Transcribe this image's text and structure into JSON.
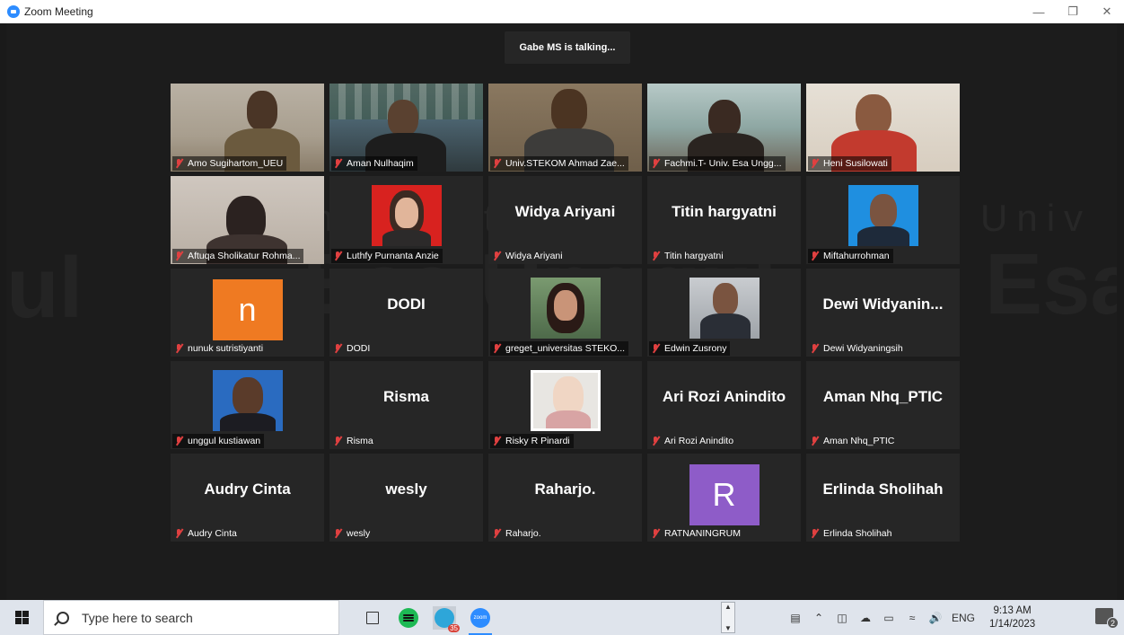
{
  "window": {
    "title": "Zoom Meeting"
  },
  "meeting": {
    "speaker_banner": "Gabe MS is talking...",
    "watermark_line1": "Univ",
    "watermark_line1b": "ersitas",
    "watermark_line2": "Esa Unggul",
    "watermark_line2b": "Esa",
    "watermark_line2c": "ul"
  },
  "participants": [
    {
      "label": "Amo Sugihartom_UEU",
      "kind": "video"
    },
    {
      "label": "Aman Nulhaqim",
      "kind": "video"
    },
    {
      "label": "Univ.STEKOM Ahmad Zae...",
      "kind": "video"
    },
    {
      "label": "Fachmi.T- Univ. Esa Ungg...",
      "kind": "video"
    },
    {
      "label": "Heni Susilowati",
      "kind": "video"
    },
    {
      "label": "Aftuqa Sholikatur Rohma...",
      "kind": "video"
    },
    {
      "label": "Luthfy Purnanta Anzie",
      "kind": "photo"
    },
    {
      "label": "Widya Ariyani",
      "big": "Widya Ariyani",
      "kind": "name"
    },
    {
      "label": "Titin hargyatni",
      "big": "Titin hargyatni",
      "kind": "name"
    },
    {
      "label": "Miftahurrohman",
      "kind": "photo"
    },
    {
      "label": "nunuk sutristiyanti",
      "letter": "n",
      "kind": "letter"
    },
    {
      "label": "DODI",
      "big": "DODI",
      "kind": "name"
    },
    {
      "label": "greget_universitas STEKO...",
      "kind": "photo"
    },
    {
      "label": "Edwin Zusrony",
      "kind": "photo"
    },
    {
      "label": "Dewi Widyaningsih",
      "big": "Dewi  Widyanin...",
      "kind": "name"
    },
    {
      "label": "unggul kustiawan",
      "kind": "photo"
    },
    {
      "label": "Risma",
      "big": "Risma",
      "kind": "name"
    },
    {
      "label": "Risky R Pinardi",
      "kind": "photo"
    },
    {
      "label": "Ari Rozi Anindito",
      "big": "Ari Rozi Anindito",
      "kind": "name"
    },
    {
      "label": "Aman Nhq_PTIC",
      "big": "Aman Nhq_PTIC",
      "kind": "name"
    },
    {
      "label": "Audry Cinta",
      "big": "Audry Cinta",
      "kind": "name"
    },
    {
      "label": "wesly",
      "big": "wesly",
      "kind": "name"
    },
    {
      "label": "Raharjo.",
      "big": "Raharjo.",
      "kind": "name"
    },
    {
      "label": "RATNANINGRUM",
      "letter": "R",
      "kind": "letter"
    },
    {
      "label": "Erlinda Sholihah",
      "big": "Erlinda Sholihah",
      "kind": "name"
    }
  ],
  "taskbar": {
    "search_placeholder": "Type here to search",
    "telegram_badge": "35",
    "zoom_icon_text": "zoom",
    "language": "ENG",
    "time": "9:13 AM",
    "date": "1/14/2023",
    "notification_count": "2"
  },
  "colors": {
    "tile_bg": "#262626",
    "mute_red": "#e04040",
    "nunuk_avatar": "#ef7a22",
    "ratna_avatar": "#8e5cc8",
    "zoom_blue": "#2d8cff"
  }
}
